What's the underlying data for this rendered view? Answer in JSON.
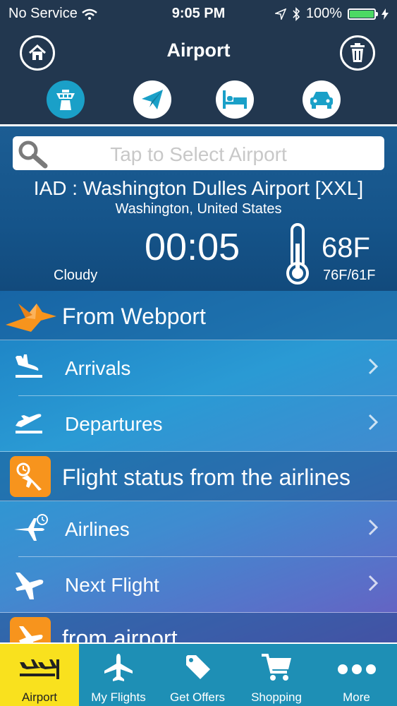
{
  "status_bar": {
    "carrier": "No Service",
    "time": "9:05 PM",
    "battery": "100%",
    "battery_level": 1.0
  },
  "header": {
    "title": "Airport",
    "home_icon": "home-icon",
    "trash_icon": "trash-icon",
    "categories": [
      {
        "icon": "control-tower-icon",
        "active": true
      },
      {
        "icon": "paper-plane-icon",
        "active": false
      },
      {
        "icon": "bed-icon",
        "active": false
      },
      {
        "icon": "car-icon",
        "active": false
      }
    ]
  },
  "info": {
    "search_placeholder": "Tap to Select Airport",
    "airport_name": "IAD : Washington Dulles Airport [XXL]",
    "city": "Washington, United States",
    "local_time": "00:05",
    "condition": "Cloudy",
    "temperature": "68F",
    "temp_range": "76F/61F"
  },
  "list": {
    "section1": "From Webport",
    "arrivals": "Arrivals",
    "departures": "Departures",
    "section2": "Flight status from the airlines",
    "airlines": "Airlines",
    "next_flight": "Next Flight",
    "section3": "from airport"
  },
  "tabs": [
    {
      "label": "Airport",
      "icon": "airport-icon",
      "active": true
    },
    {
      "label": "My Flights",
      "icon": "airplane-icon",
      "active": false
    },
    {
      "label": "Get Offers",
      "icon": "tag-icon",
      "active": false
    },
    {
      "label": "Shopping",
      "icon": "cart-icon",
      "active": false
    },
    {
      "label": "More",
      "icon": "more-icon",
      "active": false
    }
  ],
  "colors": {
    "header_bg": "#22374f",
    "accent": "#1aa0c8",
    "active_tab": "#f9e11e",
    "orange": "#f7941d",
    "battery": "#4cd964"
  }
}
